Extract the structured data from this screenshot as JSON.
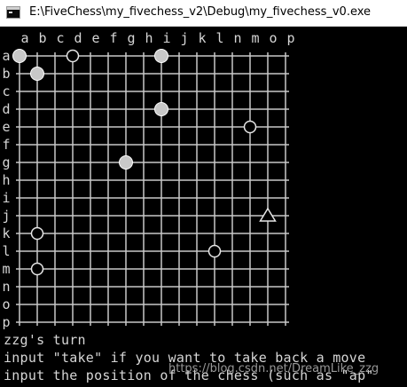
{
  "window": {
    "title": "E:\\FiveChess\\my_fivechess_v2\\Debug\\my_fivechess_v0.exe",
    "icon": "console-app-icon"
  },
  "board": {
    "column_labels": [
      "a",
      "b",
      "c",
      "d",
      "e",
      "f",
      "g",
      "h",
      "i",
      "j",
      "k",
      "l",
      "n",
      "m",
      "o",
      "p"
    ],
    "row_labels": [
      "a",
      "b",
      "c",
      "d",
      "e",
      "f",
      "g",
      "h",
      "i",
      "j",
      "k",
      "l",
      "m",
      "n",
      "o",
      "p"
    ],
    "colors": {
      "grid": "#c8c8c8",
      "label": "#d6d6d6",
      "filled_stone": "#c8c8c8",
      "hollow_stone": "#000000"
    },
    "stones": [
      {
        "row": 0,
        "col": 0,
        "kind": "filled"
      },
      {
        "row": 0,
        "col": 3,
        "kind": "hollow"
      },
      {
        "row": 0,
        "col": 8,
        "kind": "filled"
      },
      {
        "row": 1,
        "col": 1,
        "kind": "filled"
      },
      {
        "row": 3,
        "col": 8,
        "kind": "filled"
      },
      {
        "row": 4,
        "col": 13,
        "kind": "hollow"
      },
      {
        "row": 6,
        "col": 6,
        "kind": "filled"
      },
      {
        "row": 9,
        "col": 14,
        "kind": "triangle"
      },
      {
        "row": 10,
        "col": 1,
        "kind": "hollow"
      },
      {
        "row": 11,
        "col": 11,
        "kind": "hollow"
      },
      {
        "row": 12,
        "col": 1,
        "kind": "hollow"
      }
    ]
  },
  "console": {
    "lines": [
      "zzg's turn",
      "input \"take\" if you want to take back a move",
      "input the position of the chess (such as \"ap\""
    ]
  },
  "watermark": "https://blog.csdn.net/DreamLike_zzg"
}
